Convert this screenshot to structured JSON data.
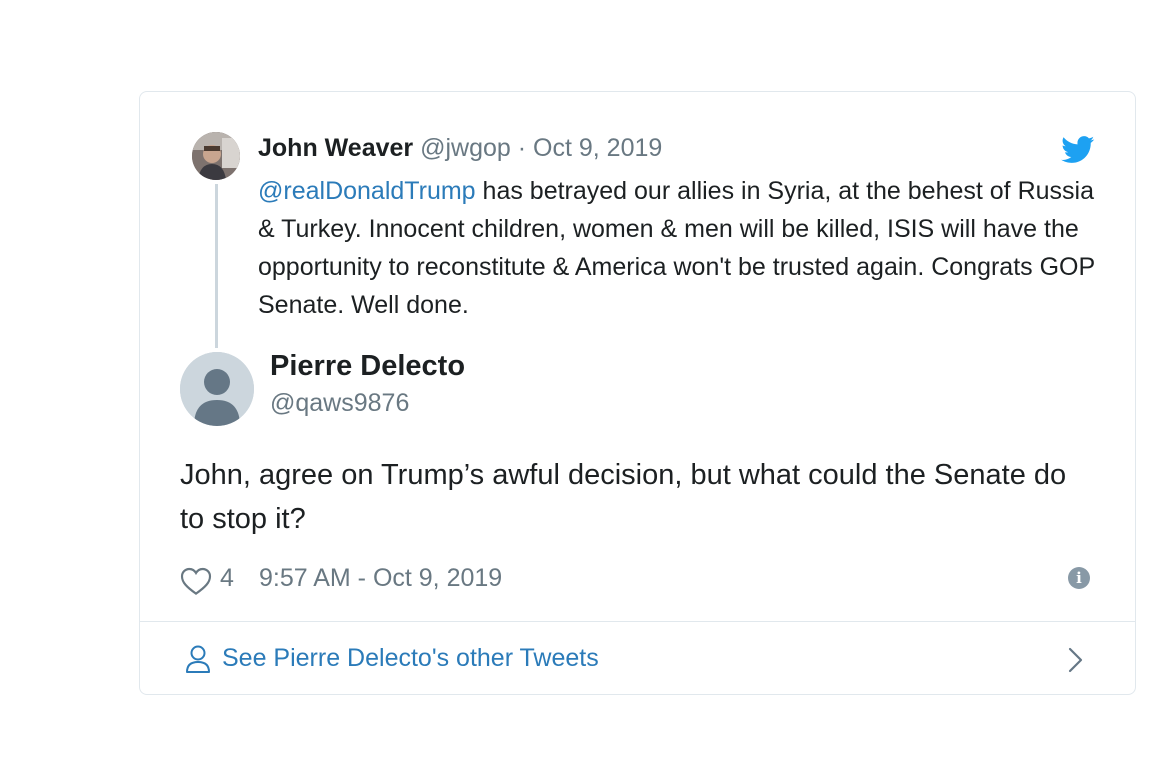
{
  "quoted_tweet": {
    "author_name": "John Weaver",
    "author_handle": "@jwgop",
    "separator": "·",
    "date": "Oct 9, 2019",
    "mention": "@realDonaldTrump",
    "text": " has betrayed our allies in Syria, at the behest of Russia & Turkey. Innocent children, women & men will be killed, ISIS will have the opportunity to reconstitute & America won't be trusted again. Congrats GOP Senate. Well done."
  },
  "reply_tweet": {
    "author_name": "Pierre Delecto",
    "author_handle": "@qaws9876",
    "text": "John, agree on Trump’s awful decision, but what could the Senate do to stop it?",
    "like_count": "4",
    "timestamp": "9:57 AM - Oct 9, 2019"
  },
  "footer": {
    "see_more_label": "See Pierre Delecto's other Tweets"
  },
  "icons": {
    "brand": "twitter-bird-icon",
    "like": "heart-icon",
    "info": "info-icon",
    "profile": "person-icon",
    "navigate": "chevron-right-icon"
  },
  "colors": {
    "link": "#2b7bb9",
    "bird": "#1da1f2",
    "muted": "#697882",
    "text": "#1c2022",
    "border": "#e1e8ed"
  }
}
